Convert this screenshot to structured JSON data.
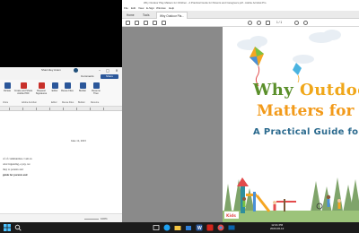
{
  "word": {
    "user_name": "Sharmiley Anam",
    "tabs": {
      "comments": "Comments",
      "share": "Share"
    },
    "ribbon": {
      "buttons": [
        {
          "label": "Dictate",
          "icon": "microphone-icon",
          "color": "#2b579a"
        },
        {
          "label": "Create and Share Adobe PDF",
          "icon": "pdf-icon",
          "color": "#c8312b"
        },
        {
          "label": "Request Signatures",
          "icon": "signature-icon",
          "color": "#c8312b"
        },
        {
          "label": "Editor",
          "icon": "editor-icon",
          "color": "#2b579a"
        },
        {
          "label": "Reuse Files",
          "icon": "reuse-files-icon",
          "color": "#2b579a"
        },
        {
          "label": "Builder",
          "icon": "builder-icon",
          "color": "#2b579a"
        },
        {
          "label": "Resume Then",
          "icon": "resume-icon",
          "color": "#2b579a"
        }
      ],
      "groups": [
        "Voice",
        "Adobe Acrobat",
        "Editor",
        "Reuse Files",
        "Builder",
        "Resume"
      ]
    },
    "document": {
      "date": "June 12, 2023",
      "lines": [
        "of of communities. I am an",
        "orter ingeuring, e pay, we",
        "they to parents and",
        "guide for parents and"
      ]
    },
    "status": {
      "zoom": "100%"
    }
  },
  "pdf": {
    "window_title": "Why Outdoor Play Matters for Children - A Practical Guide for Parents and Caregivers.pdf - Adobe Acrobat Pro",
    "menu": [
      "File",
      "Edit",
      "View",
      "E-Sign",
      "Window",
      "Help"
    ],
    "tabs": [
      "Home",
      "Tools",
      "Why Outdoor Pla..."
    ],
    "page_indicator": "1 / 1",
    "cover": {
      "title_line1": "Why Outdoor P",
      "title_line2": "Matters for Child",
      "subtitle": "A Practical Guide for Parents and Ca",
      "logo_text": "Kids"
    },
    "colors": {
      "title_green": "#5a8f2a",
      "title_orange": "#f29a1a",
      "subtitle_blue": "#2b6a8e"
    }
  },
  "taskbar": {
    "icons": [
      "windows-start-icon",
      "search-icon",
      "task-view-icon",
      "edge-icon",
      "file-explorer-icon",
      "store-icon",
      "word-icon",
      "acrobat-icon",
      "chrome-icon",
      "mail-icon"
    ],
    "time": "12:41 PM",
    "date": "2023-06-12"
  }
}
